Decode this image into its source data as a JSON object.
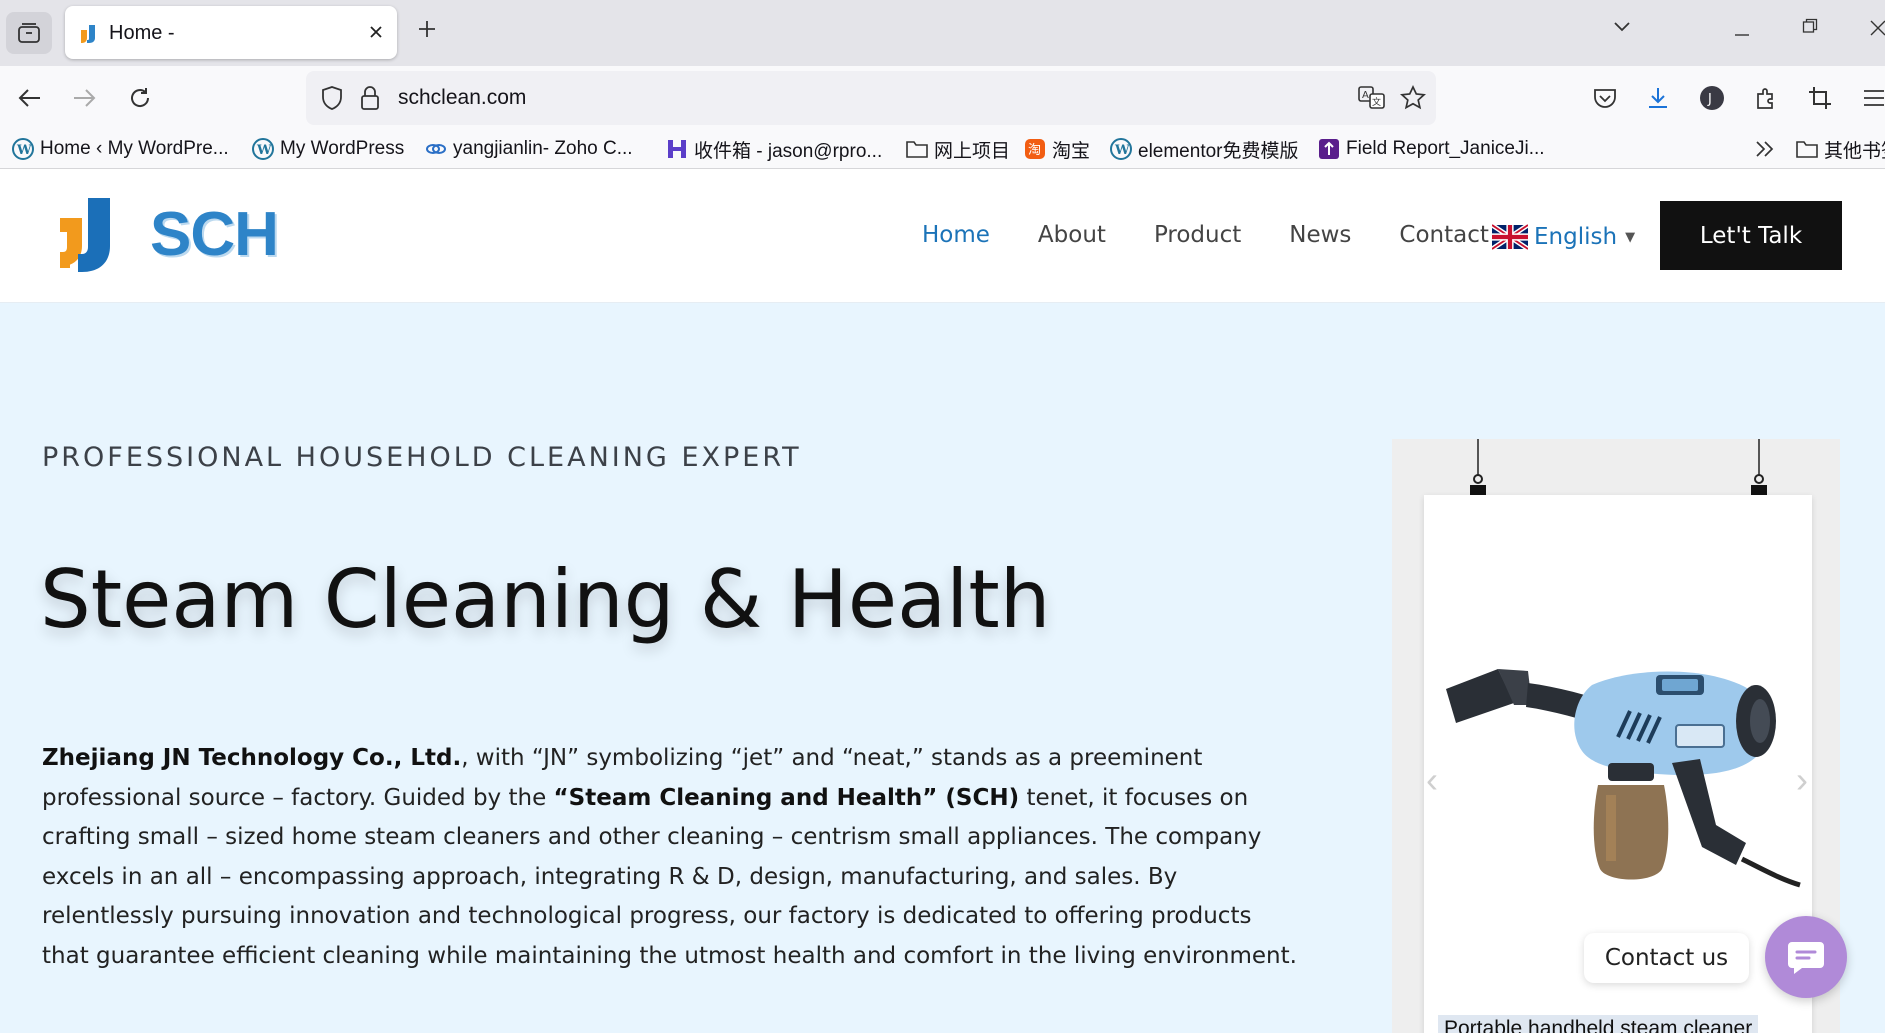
{
  "browser": {
    "tab_title": "Home -",
    "url": "schclean.com",
    "bookmarks": [
      {
        "label": "Home ‹ My WordPre...",
        "icon": "wordpress-icon"
      },
      {
        "label": "My WordPress",
        "icon": "wordpress-icon"
      },
      {
        "label": "yangjianlin- Zoho C...",
        "icon": "zoho-icon"
      },
      {
        "label": "收件箱 - jason@rpro...",
        "icon": "mail-icon"
      },
      {
        "label": "网上项目",
        "icon": "folder-icon"
      },
      {
        "label": "淘宝",
        "icon": "taobao-icon"
      },
      {
        "label": "elementor免费模版",
        "icon": "wordpress-icon"
      },
      {
        "label": "Field Report_JaniceJi...",
        "icon": "bookmark-icon"
      },
      {
        "label": "其他书签",
        "icon": "folder-icon"
      }
    ]
  },
  "site": {
    "logo_text": "SCH",
    "menu": {
      "home": "Home",
      "about": "About",
      "product": "Product",
      "news": "News",
      "contact": "Contact"
    },
    "language": "English",
    "cta": "Let't Talk"
  },
  "hero": {
    "eyebrow": "PROFESSIONAL HOUSEHOLD CLEANING EXPERT",
    "headline": "Steam Cleaning & Health",
    "intro": {
      "company": "Zhejiang JN Technology Co., Ltd.",
      "part1": ", with “JN” symbolizing “jet” and “neat,” stands as a preeminent professional source – factory. Guided by the ",
      "tenet": "“Steam Cleaning and Health” (SCH)",
      "part2": " tenet, it focuses on crafting small – sized home steam cleaners and other cleaning – centrism small appliances. The company excels in an all – encompassing approach, integrating R & D, design, manufacturing, and sales. By relentlessly pursuing innovation and technological progress, our factory is dedicated to offering products that guarantee efficient cleaning while maintaining the utmost health and comfort in the living environment."
    },
    "product_caption": "Portable handheld steam cleaner"
  },
  "widgets": {
    "contact_label": "Contact us"
  },
  "colors": {
    "hero_bg": "#e8f5fe",
    "accent": "#1b73b8",
    "cta_bg": "#111111",
    "chat_bg": "#b08ad8"
  }
}
